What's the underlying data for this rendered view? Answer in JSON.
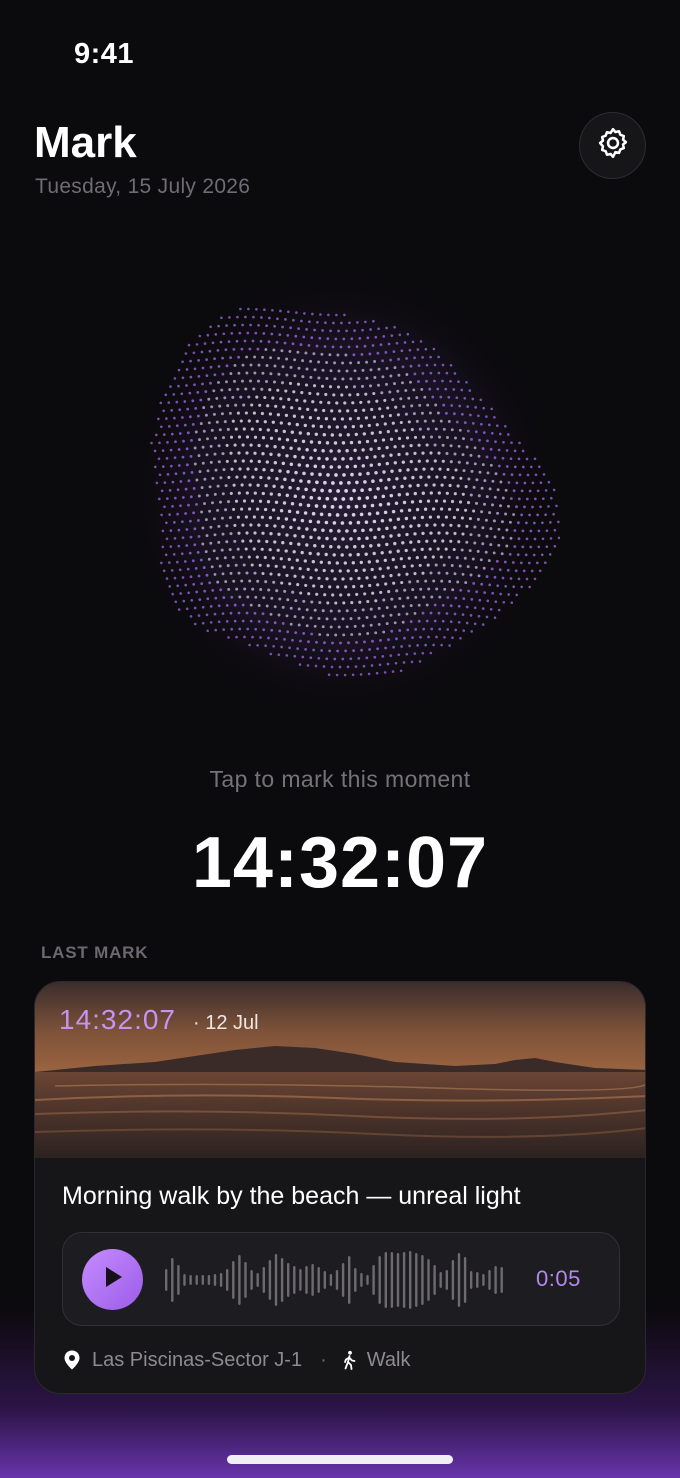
{
  "status_bar": {
    "time": "9:41"
  },
  "header": {
    "title": "Mark",
    "date": "Tuesday, 15 July 2026",
    "settings_icon": "gear-icon"
  },
  "orb": {
    "icon": "particle-orb",
    "color": "#a66cf0"
  },
  "hint": "Tap to mark this moment",
  "clock": "14:32:07",
  "last_mark": {
    "section_label": "LAST MARK",
    "time": "14:32:07",
    "date": "· 12 Jul",
    "note": "Morning walk by the beach — unreal light",
    "audio": {
      "duration": "0:05",
      "play_icon": "play-icon"
    },
    "location": "Las Piscinas-Sector J-1",
    "separator": "·",
    "activity": "Walk",
    "location_icon": "location-pin-icon",
    "activity_icon": "walking-person-icon"
  },
  "colors": {
    "accent": "#b387ec",
    "background": "#0b0a0d"
  }
}
